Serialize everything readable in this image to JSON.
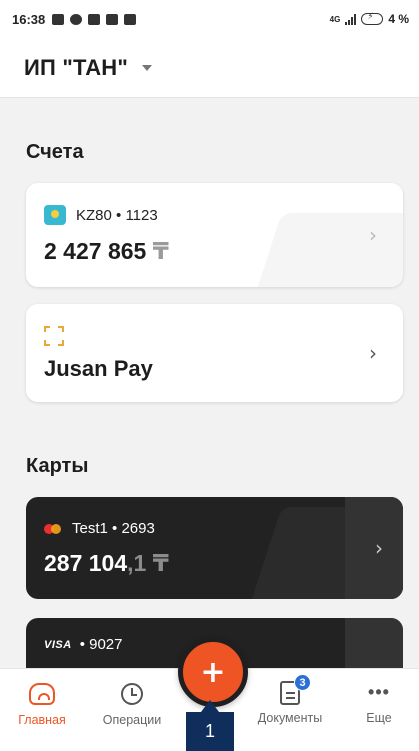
{
  "status_bar": {
    "time": "16:38",
    "network": "4G",
    "battery": "4 %"
  },
  "header": {
    "company": "ИП \"ТАН\""
  },
  "accounts_section": {
    "title": "Счета",
    "items": [
      {
        "account": "KZ80 • 1123",
        "balance": "2 427 865",
        "currency": "₸"
      },
      {
        "title": "Jusan Pay"
      }
    ]
  },
  "cards_section": {
    "title": "Карты",
    "items": [
      {
        "name": "Test1 • 2693",
        "balance_main": "287 104",
        "balance_fraction": ",1",
        "currency": "₸"
      },
      {
        "brand": "VISA",
        "number": "• 9027"
      }
    ]
  },
  "bottom_nav": {
    "items": [
      {
        "label": "Главная",
        "active": true
      },
      {
        "label": "Операции"
      },
      {
        "label": "Документы",
        "badge": "3"
      },
      {
        "label": "Еще"
      }
    ],
    "fab_label": "+"
  },
  "tooltip": {
    "label": "1"
  },
  "colors": {
    "accent": "#ef5524",
    "dark_card": "#222222",
    "badge": "#2b6fd6",
    "tooltip": "#0f2e5c"
  }
}
